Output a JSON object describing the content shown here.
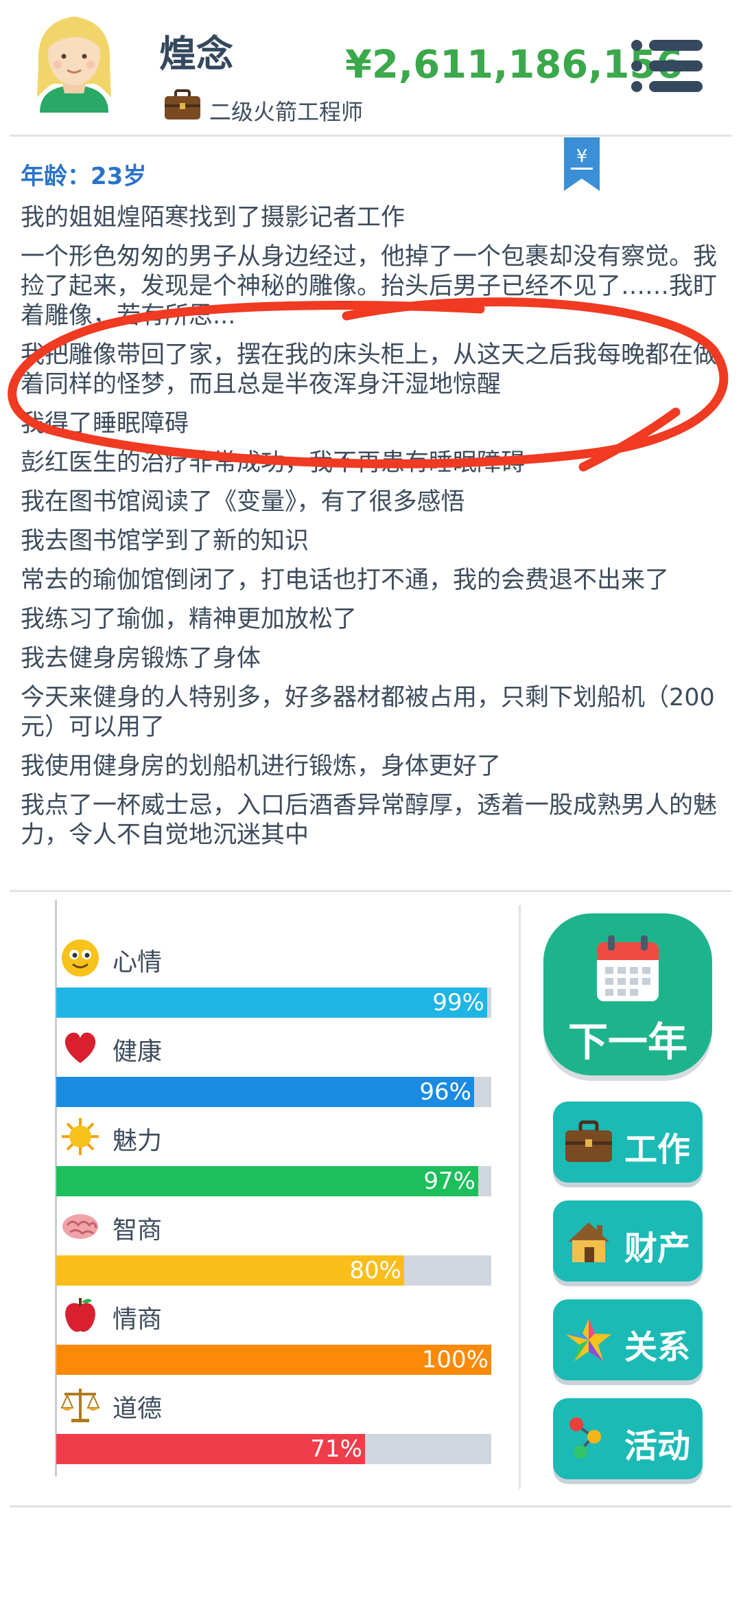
{
  "header": {
    "name": "煌念",
    "job_title": "二级火箭工程师",
    "money": "¥2,611,186,156"
  },
  "log": {
    "age": "年龄：23岁",
    "lines": [
      "我的姐姐煌陌寒找到了摄影记者工作",
      "一个形色匆匆的男子从身边经过，他掉了一个包裹却没有察觉。我捡了起来，发现是个神秘的雕像。抬头后男子已经不见了……我盯着雕像，若有所思...",
      "我把雕像带回了家，摆在我的床头柜上，从这天之后我每晚都在做着同样的怪梦，而且总是半夜浑身汗湿地惊醒",
      "我得了睡眠障碍",
      "彭红医生的治疗非常成功，我不再患有睡眠障碍",
      "我在图书馆阅读了《变量》，有了很多感悟",
      "我去图书馆学到了新的知识",
      "常去的瑜伽馆倒闭了，打电话也打不通，我的会费退不出来了",
      "我练习了瑜伽，精神更加放松了",
      "我去健身房锻炼了身体",
      "今天来健身的人特别多，好多器材都被占用，只剩下划船机（200元）可以用了",
      "我使用健身房的划船机进行锻炼，身体更好了",
      "我点了一杯威士忌，入口后酒香异常醇厚，透着一股成熟男人的魅力，令人不自觉地沉迷其中"
    ]
  },
  "stats": [
    {
      "label": "心情",
      "value": 0.99,
      "display": "99%",
      "color": "#1fb5e5",
      "icon": "smiley-icon"
    },
    {
      "label": "健康",
      "value": 0.96,
      "display": "96%",
      "color": "#1a8be0",
      "icon": "heart-icon"
    },
    {
      "label": "魅力",
      "value": 0.97,
      "display": "97%",
      "color": "#1cbf5a",
      "icon": "sun-icon"
    },
    {
      "label": "智商",
      "value": 0.8,
      "display": "80%",
      "color": "#fbbd1a",
      "icon": "brain-icon"
    },
    {
      "label": "情商",
      "value": 1.0,
      "display": "100%",
      "color": "#fb8a08",
      "icon": "apple-icon"
    },
    {
      "label": "道德",
      "value": 0.71,
      "display": "71%",
      "color": "#ef3d4a",
      "icon": "scales-icon"
    }
  ],
  "actions": {
    "next_year": "下一年",
    "work": "工作",
    "property": "财产",
    "relations": "关系",
    "activities": "活动"
  },
  "colors": {
    "money": "#3aa84b",
    "age": "#2a73c8",
    "next_year_bg": "#1eb48b",
    "side_btn_bg": "#1bbab5",
    "annotation": "#f03a22"
  }
}
